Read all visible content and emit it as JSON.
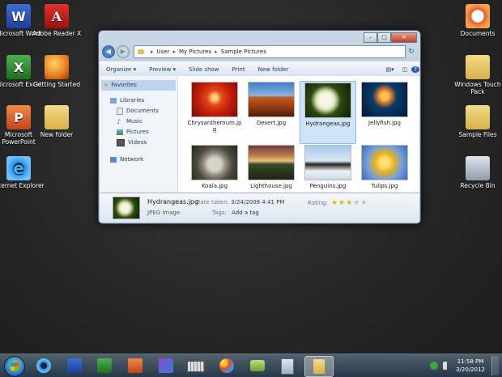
{
  "desktop": {
    "icons_left": [
      {
        "name": "word",
        "label": "Microsoft Word",
        "icon": "word-icon"
      },
      {
        "name": "adobe",
        "label": "Adobe Reader X",
        "icon": "adobe-reader-icon"
      },
      {
        "name": "excel",
        "label": "Microsoft Excel",
        "icon": "excel-icon"
      },
      {
        "name": "getting-started",
        "label": "Getting Started",
        "icon": "getting-started-icon"
      },
      {
        "name": "powerpoint",
        "label": "Microsoft PowerPoint",
        "icon": "powerpoint-icon"
      },
      {
        "name": "new-folder",
        "label": "New folder",
        "icon": "folder-icon"
      },
      {
        "name": "ie",
        "label": "Internet Explorer",
        "icon": "internet-explorer-icon"
      }
    ],
    "icons_right": [
      {
        "name": "documents",
        "label": "Documents",
        "icon": "documents-icon"
      },
      {
        "name": "touch-pack",
        "label": "Windows Touch Pack",
        "icon": "folder-icon"
      },
      {
        "name": "sample-files",
        "label": "Sample Files",
        "icon": "folder-icon"
      },
      {
        "name": "recycle-bin",
        "label": "Recycle Bin",
        "icon": "recycle-bin-icon"
      }
    ]
  },
  "explorer": {
    "window_controls": {
      "minimize": "–",
      "maximize": "□",
      "close": "✕"
    },
    "breadcrumb": [
      "User",
      "My Pictures",
      "Sample Pictures"
    ],
    "toolbar": {
      "organize": "Organize ▾",
      "preview": "Preview ▾",
      "slideshow": "Slide show",
      "print": "Print",
      "new_folder": "New folder"
    },
    "nav": {
      "favorites": "Favorites",
      "libraries": "Libraries",
      "library_items": [
        "Documents",
        "Music",
        "Pictures",
        "Videos"
      ],
      "network": "Network"
    },
    "files": [
      {
        "name": "Chrysanthemum.jpg",
        "thumb": "chrysanthemum",
        "selected": false
      },
      {
        "name": "Desert.jpg",
        "thumb": "desert",
        "selected": false
      },
      {
        "name": "Hydrangeas.jpg",
        "thumb": "hydrangeas",
        "selected": true
      },
      {
        "name": "Jellyfish.jpg",
        "thumb": "jellyfish",
        "selected": false
      },
      {
        "name": "Koala.jpg",
        "thumb": "koala",
        "selected": false
      },
      {
        "name": "Lighthouse.jpg",
        "thumb": "lighthouse",
        "selected": false
      },
      {
        "name": "Penguins.jpg",
        "thumb": "penguins",
        "selected": false
      },
      {
        "name": "Tulips.jpg",
        "thumb": "tulips",
        "selected": false
      }
    ],
    "details": {
      "name": "Hydrangeas.jpg",
      "type": "JPEG image",
      "date_label": "Date taken:",
      "date_value": "3/24/2008 4:41 PM",
      "tags_label": "Tags:",
      "tags_value": "Add a tag",
      "rating_label": "Rating:",
      "rating": 3,
      "rating_max": 5
    }
  },
  "taskbar": {
    "buttons": [
      "start-button",
      "internet-explorer-icon",
      "word-icon",
      "excel-icon",
      "powerpoint-icon",
      "media-center-icon",
      "keyboard-icon",
      "paint-icon",
      "messenger-icon",
      "notepad-icon",
      "explorer-icon"
    ],
    "active_button": "explorer-icon",
    "time": "11:58 PM",
    "date": "3/20/2012"
  }
}
